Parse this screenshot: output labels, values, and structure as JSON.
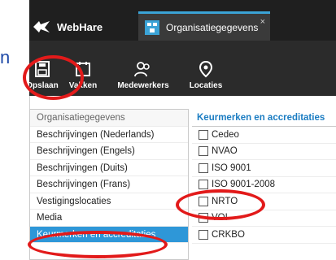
{
  "partial_text": "n",
  "brand": {
    "name": "WebHare"
  },
  "tab": {
    "label": "Organisatiegegevens",
    "close": "×"
  },
  "toolbar": {
    "save_label": "Opslaan",
    "fields_label": "Vakken",
    "staff_label": "Medewerkers",
    "locations_label": "Locaties"
  },
  "left_list": [
    "Organisatiegegevens",
    "Beschrijvingen (Nederlands)",
    "Beschrijvingen (Engels)",
    "Beschrijvingen (Duits)",
    "Beschrijvingen (Frans)",
    "Vestigingslocaties",
    "Media",
    "Keurmerken en accreditaties"
  ],
  "right_pane": {
    "header": "Keurmerken en accreditaties",
    "items": [
      "Cedeo",
      "NVAO",
      "ISO 9001",
      "ISO 9001-2008",
      "NRTO",
      "VOI",
      "CRKBO"
    ]
  },
  "colors": {
    "accent": "#2e97d8",
    "annotation": "#e21a1a",
    "header_text": "#1a7cc2"
  }
}
